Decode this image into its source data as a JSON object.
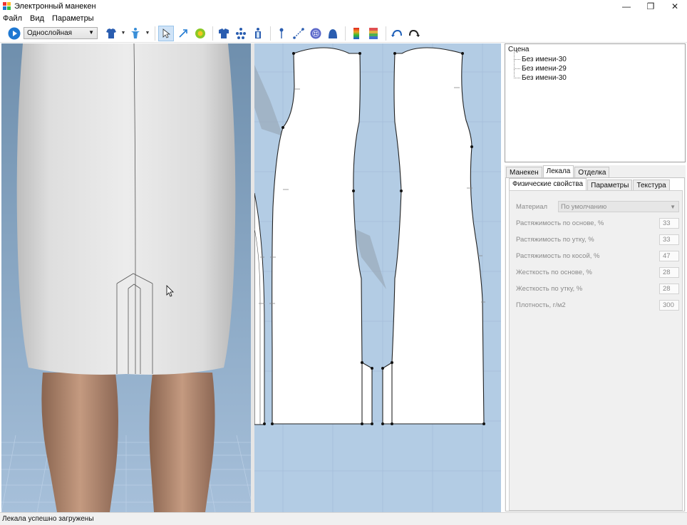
{
  "window": {
    "title": "Электронный манекен",
    "buttons": {
      "minimize": "—",
      "restore": "❐",
      "close": "✕"
    }
  },
  "menu": [
    "Файл",
    "Вид",
    "Параметры"
  ],
  "toolbar": {
    "layer_mode": "Однослойная",
    "icons": [
      "play-icon",
      "garment-icon",
      "mannequin-icon",
      "select-arrow-icon",
      "draw-arrow-icon",
      "gear-flower-icon",
      "tshirt-icon",
      "points-icon",
      "figure-icon",
      "pin-icon",
      "measure-icon",
      "button-icon",
      "hat-icon",
      "gradient-icon",
      "stretch-map-icon",
      "undo-icon",
      "redo-icon"
    ]
  },
  "scene": {
    "title": "Сцена",
    "items": [
      "Без имени-30",
      "Без имени-29",
      "Без имени-30"
    ]
  },
  "tabs": {
    "main": [
      "Манекен",
      "Лекала",
      "Отделка"
    ],
    "main_active": "Лекала",
    "sub": [
      "Физические свойства",
      "Параметры",
      "Текстура"
    ],
    "sub_active": "Физические свойства"
  },
  "properties": {
    "material_label": "Материал",
    "material_value": "По умолчанию",
    "rows": [
      {
        "label": "Растяжимость по основе, %",
        "value": "33"
      },
      {
        "label": "Растяжимость по утку, %",
        "value": "33"
      },
      {
        "label": "Растяжимость по косой, %",
        "value": "47"
      },
      {
        "label": "Жесткость по основе, %",
        "value": "28"
      },
      {
        "label": "Жесткость по утку, %",
        "value": "28"
      },
      {
        "label": "Плотность, г/м2",
        "value": "300"
      }
    ]
  },
  "status": "Лекала успешно загружены",
  "colors": {
    "accent": "#1e78d2",
    "canvas2d": "#b3cce4",
    "selection": "#cfe3f7"
  }
}
